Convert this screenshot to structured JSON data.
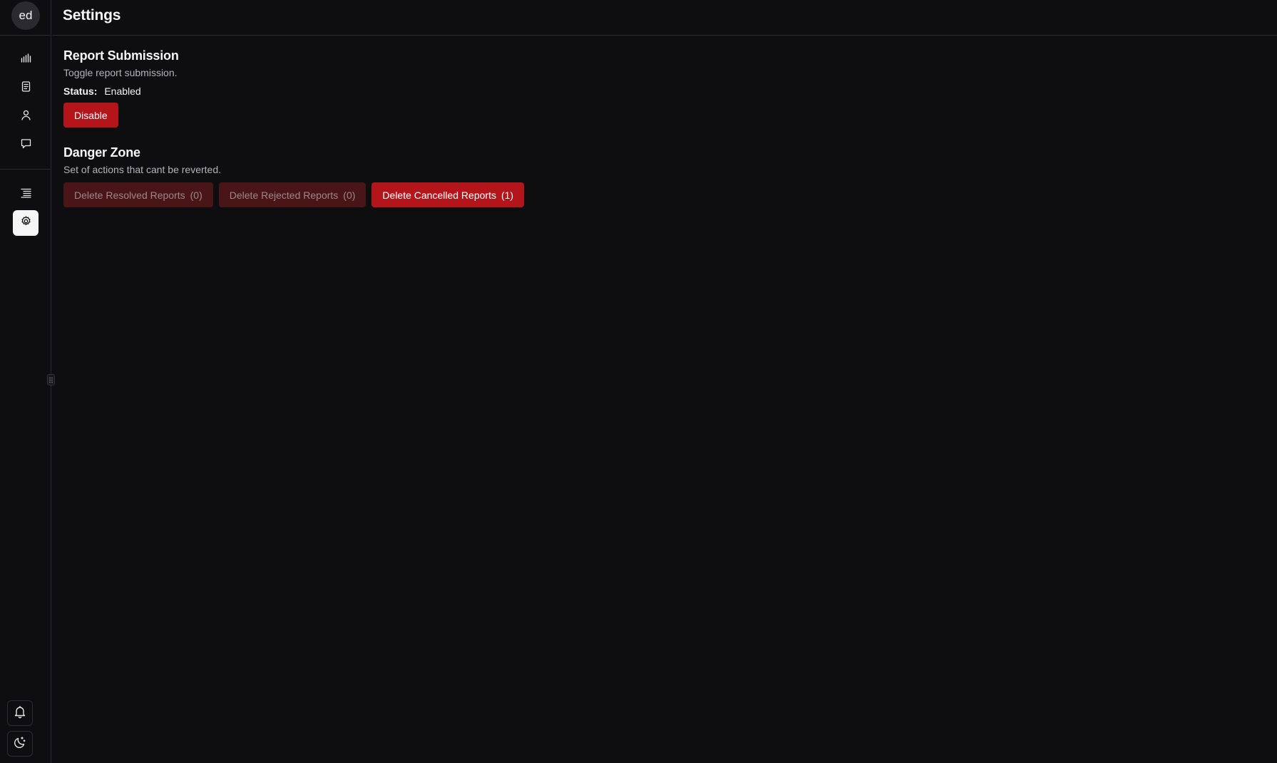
{
  "sidebar": {
    "avatar_initials": "ed",
    "nav_items": [
      {
        "name": "analytics",
        "icon": "bar-chart-icon"
      },
      {
        "name": "reports",
        "icon": "document-icon"
      },
      {
        "name": "users",
        "icon": "user-icon"
      },
      {
        "name": "messages",
        "icon": "chat-icon"
      },
      {
        "name": "logs",
        "icon": "list-icon"
      },
      {
        "name": "settings",
        "icon": "gear-icon",
        "active": true
      }
    ],
    "bottom_items": [
      {
        "name": "notifications",
        "icon": "bell-icon"
      },
      {
        "name": "theme-toggle",
        "icon": "moon-icon"
      }
    ]
  },
  "header": {
    "title": "Settings"
  },
  "report_submission": {
    "title": "Report Submission",
    "description": "Toggle report submission.",
    "status_label": "Status:",
    "status_value": "Enabled",
    "toggle_button_label": "Disable"
  },
  "danger_zone": {
    "title": "Danger Zone",
    "description": "Set of actions that cant be reverted.",
    "buttons": [
      {
        "label": "Delete Resolved Reports",
        "count": "(0)",
        "enabled": false
      },
      {
        "label": "Delete Rejected Reports",
        "count": "(0)",
        "enabled": false
      },
      {
        "label": "Delete Cancelled Reports",
        "count": "(1)",
        "enabled": true
      }
    ]
  },
  "colors": {
    "background": "#0e0e11",
    "danger": "#b3151a",
    "danger_disabled": "#4a1517",
    "active_nav": "#f5f5f5"
  }
}
